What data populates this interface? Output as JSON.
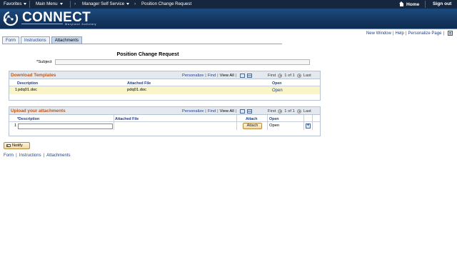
{
  "topnav": {
    "favorites": "Favorites",
    "main_menu": "Main Menu",
    "breadcrumb_1": "Manager Self Service",
    "breadcrumb_2": "Position Change Request",
    "home": "Home",
    "sign_out": "Sign out"
  },
  "banner": {
    "logo_text": "CONNECT",
    "logo_subtitle": "Maryland Judiciary"
  },
  "utility_links": {
    "new_window": "New Window",
    "help": "Help",
    "personalize_page": "Personalize Page"
  },
  "tabs": [
    {
      "label": "Form",
      "active": false
    },
    {
      "label": "Instructions",
      "active": false
    },
    {
      "label": "Attachments",
      "active": true
    }
  ],
  "page": {
    "title": "Position Change Request",
    "subject_label": "*Subject",
    "subject_value": ""
  },
  "download_grid": {
    "title": "Download Templates",
    "personalize": "Personalize",
    "find": "Find",
    "view_all": "View All",
    "first": "First",
    "pagination": "1 of 1",
    "last": "Last",
    "columns": [
      "Description",
      "Attached File",
      "Open"
    ],
    "rows": [
      {
        "num": "1",
        "description": "pdq01.doc",
        "attached_file": "pdq01.doc",
        "open": "Open"
      }
    ]
  },
  "upload_grid": {
    "title": "Upload your attachments",
    "personalize": "Personalize",
    "find": "Find",
    "view_all": "View All",
    "first": "First",
    "pagination": "1 of 1",
    "last": "Last",
    "columns": [
      "*Description",
      "Attached File",
      "Attach",
      "Open"
    ],
    "rows": [
      {
        "num": "1",
        "description": "",
        "attached_file": "",
        "attach_button": "Attach",
        "open": "Open",
        "add_button": "+"
      }
    ]
  },
  "notify_button": "Notify",
  "bottom_links": {
    "form": "Form",
    "instructions": "Instructions",
    "attachments": "Attachments"
  },
  "colors": {
    "topnav_bg": "#16263d",
    "banner_bg": "#133660",
    "grid_title": "#b8591f",
    "link": "#1f3e8a",
    "highlight_row": "#f9f5c7"
  }
}
